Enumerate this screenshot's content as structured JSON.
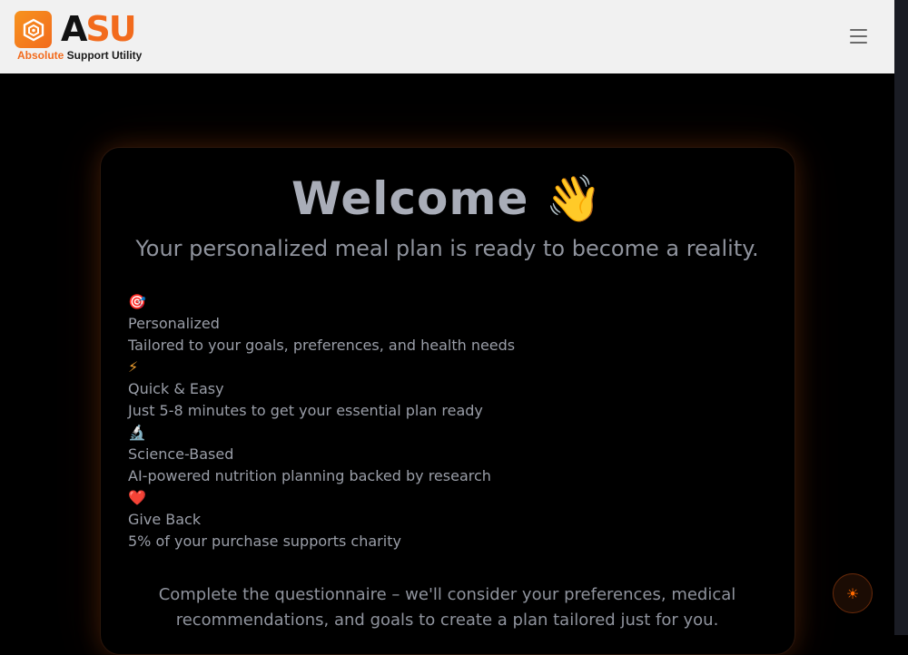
{
  "header": {
    "logo": {
      "word_a": "A",
      "word_su": "SU",
      "tagline_a": "Absolute",
      "tagline_b": " Support Utility",
      "mark_icon": "hexagon-logo-icon"
    },
    "menu_icon": "hamburger-menu-icon"
  },
  "main": {
    "title": "Welcome 👋",
    "subtitle": "Your personalized meal plan is ready to become a reality.",
    "features": [
      {
        "icon": "🎯",
        "title": "Personalized",
        "description": "Tailored to your goals, preferences, and health needs"
      },
      {
        "icon": "⚡",
        "title": "Quick & Easy",
        "description": "Just 5-8 minutes to get your essential plan ready"
      },
      {
        "icon": "🔬",
        "title": "Science-Based",
        "description": "AI-powered nutrition planning backed by research"
      },
      {
        "icon": "❤️",
        "title": "Give Back",
        "description": "5% of your purchase supports charity"
      }
    ],
    "footnote": "Complete the questionnaire – we'll consider your preferences, medical recommendations, and goals to create a plan tailored just for you."
  },
  "theme_toggle": {
    "icon": "☀",
    "icon_name": "sun-icon"
  },
  "colors": {
    "accent": "#f26b1d",
    "header_bg": "#f1f1f1",
    "page_bg": "#000000",
    "text_muted": "#9a9ea8"
  }
}
